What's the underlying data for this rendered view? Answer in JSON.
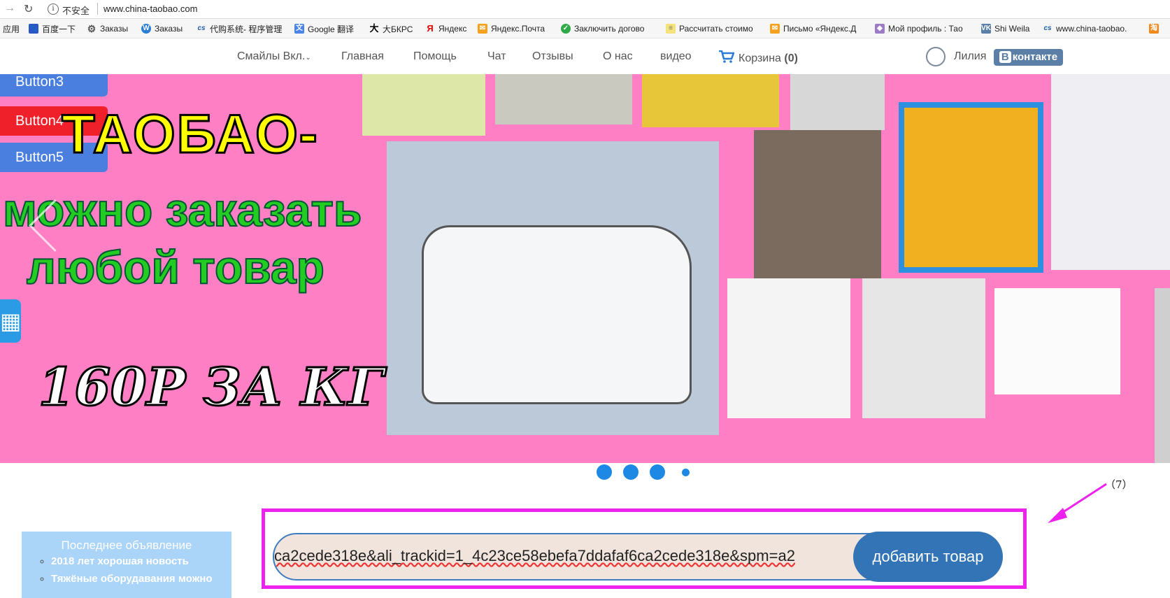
{
  "browser": {
    "security_label": "不安全",
    "url": "www.china-taobao.com"
  },
  "bookmarks": [
    {
      "icon": "apps-icon",
      "label": "应用"
    },
    {
      "icon": "baidu-icon",
      "label": "百度一下"
    },
    {
      "icon": "gear-icon",
      "label": "Заказы"
    },
    {
      "icon": "w-icon",
      "label": "Заказы"
    },
    {
      "icon": "cs-icon",
      "label": "代购系统- 程序管理"
    },
    {
      "icon": "translate-icon",
      "label": "Google 翻译"
    },
    {
      "icon": "dabkrs-icon",
      "label": "大БКРС"
    },
    {
      "icon": "yandex-icon",
      "label": "Яндекс"
    },
    {
      "icon": "mail-icon",
      "label": "Яндекс.Почта"
    },
    {
      "icon": "green-icon",
      "label": "Заключить догово"
    },
    {
      "icon": "doc-icon",
      "label": "Рассчитать стоимо"
    },
    {
      "icon": "mail-icon",
      "label": "Письмо «Яндекс.Д"
    },
    {
      "icon": "profile-icon",
      "label": "Мой профиль : Тао"
    },
    {
      "icon": "vk-icon",
      "label": "Shi Weila"
    },
    {
      "icon": "cs-icon",
      "label": "www.china-taobao."
    }
  ],
  "nav": {
    "items": [
      "Смайлы Вкл.",
      "Главная",
      "Помощь",
      "Чат",
      "Отзывы",
      "О нас",
      "видео"
    ],
    "cart_label": "Корзина",
    "cart_count": "(0)",
    "user_name": "Лилия",
    "vk_label": "контакте",
    "vk_prefix": "В"
  },
  "banner": {
    "buttons": [
      {
        "label": "Button3",
        "color": "#4a7fe0"
      },
      {
        "label": "Button4",
        "color": "#f0202a"
      },
      {
        "label": "Button5",
        "color": "#4a7fe0"
      }
    ],
    "title": "ТАОБАО-",
    "text_line1": "можно заказать",
    "text_line2": "любой товар",
    "price": "160Р ЗА КГ",
    "background": "#ff7fc5"
  },
  "carousel": {
    "dots": 4,
    "active": 4
  },
  "annotation": {
    "number": "（7）"
  },
  "search": {
    "value": "ca2cede318e&ali_trackid=1_4c23ce58ebefa7ddafaf6ca2cede318e&spm=a2",
    "button_label": "добавить товар"
  },
  "notice": {
    "title": "Последнее объявление",
    "items": [
      "2018 лет хорошая новость",
      "Тяжёные оборудавания можно"
    ]
  },
  "colors": {
    "accent": "#3274b5",
    "highlight_box": "#ee22ee",
    "dots": "#1e88e5"
  }
}
